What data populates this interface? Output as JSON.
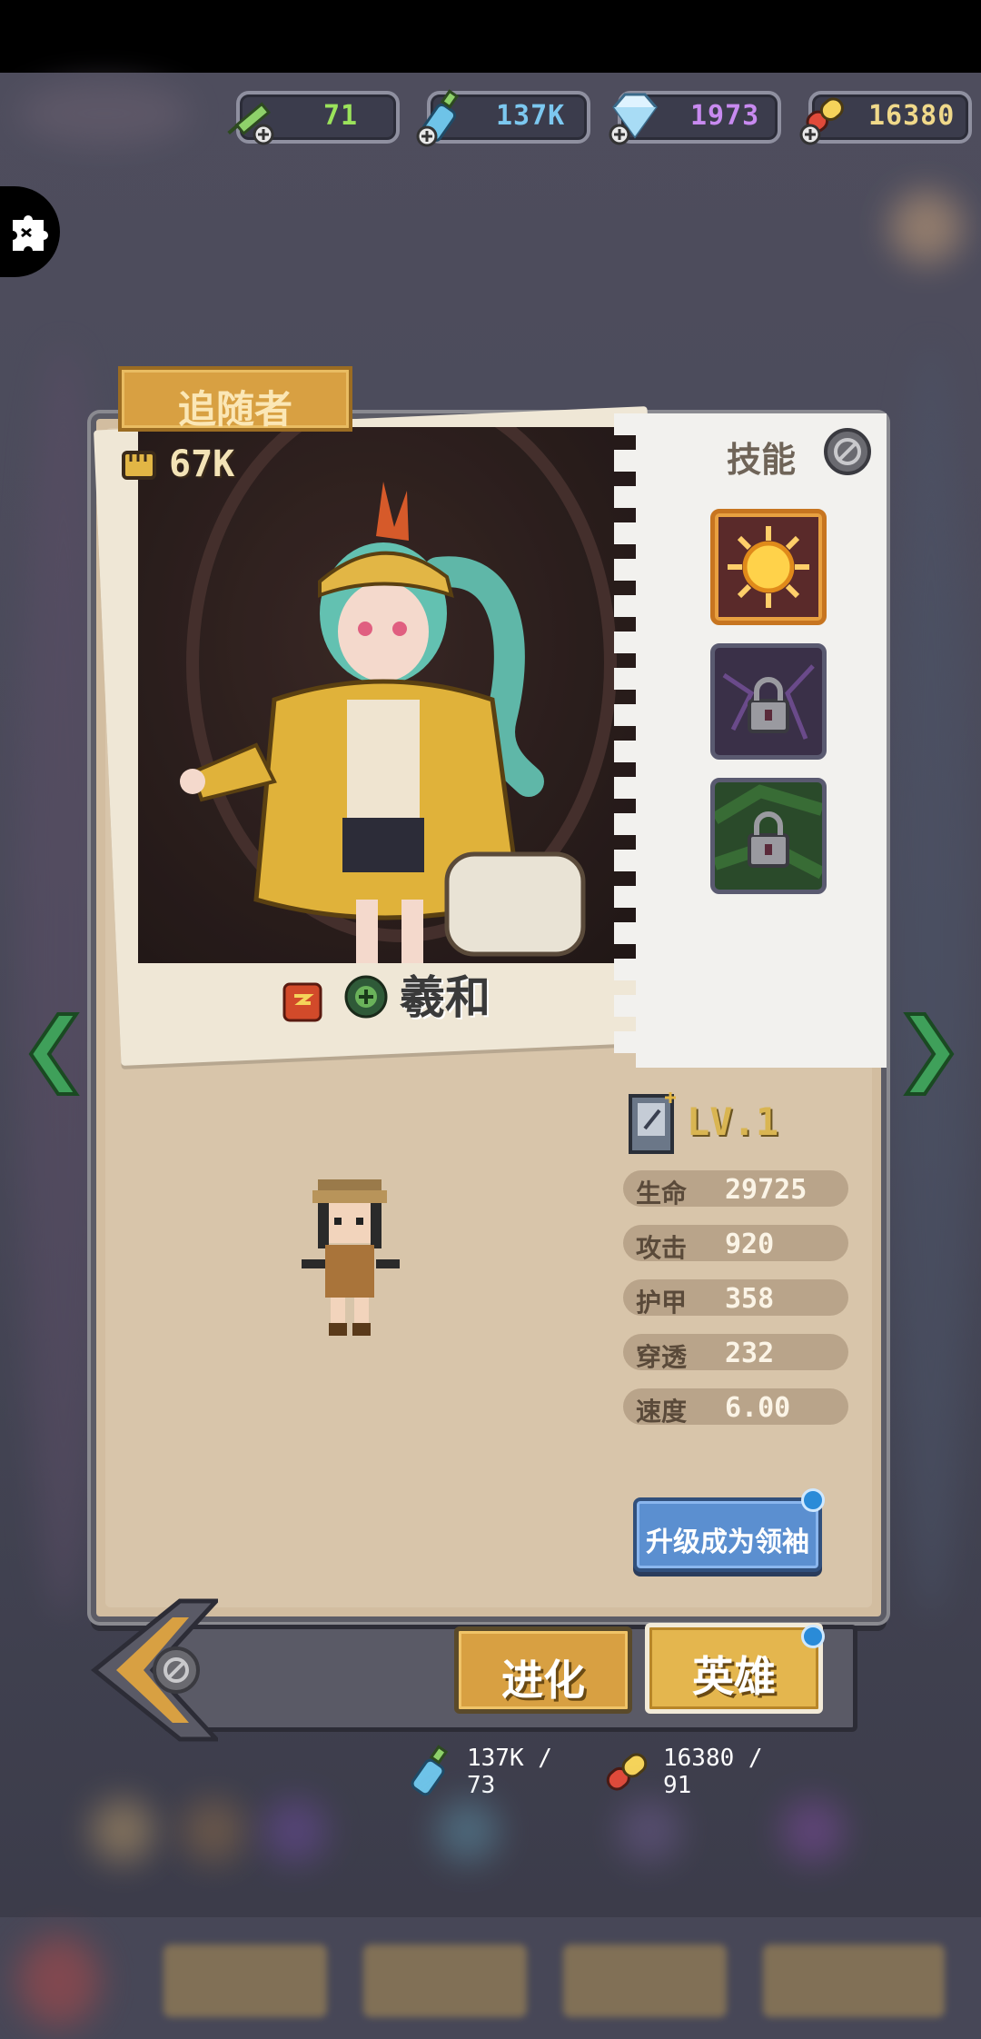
{
  "resources": [
    {
      "icon": "syringe-icon",
      "value": "71",
      "color": "#9be35b"
    },
    {
      "icon": "bottle-icon",
      "value": "137K",
      "color": "#7cc8f0"
    },
    {
      "icon": "diamond-icon",
      "value": "1973",
      "color": "#c88af0"
    },
    {
      "icon": "pill-icon",
      "value": "16380",
      "color": "#f0d98a"
    }
  ],
  "card": {
    "category": "追随者",
    "power": "67K",
    "skills_label": "技能",
    "hero_name": "羲和",
    "level": "LV.1"
  },
  "stats": [
    {
      "label": "生命",
      "value": "29725"
    },
    {
      "label": "攻击",
      "value": "920"
    },
    {
      "label": "护甲",
      "value": "358"
    },
    {
      "label": "穿透",
      "value": "232"
    },
    {
      "label": "速度",
      "value": "6.00"
    }
  ],
  "actions": {
    "upgrade_leader": "升级成为领袖",
    "evolve": "进化",
    "hero": "英雄"
  },
  "costs": [
    {
      "icon": "bottle-icon",
      "line1": "137K /",
      "line2": "73"
    },
    {
      "icon": "pill-icon",
      "line1": "16380 /",
      "line2": "91"
    }
  ],
  "colors": {
    "accent_gold": "#d8a042",
    "accent_blue": "#5b8fd0",
    "arrow_green": "#3fa05a",
    "card_bg": "#d8c5aa"
  }
}
